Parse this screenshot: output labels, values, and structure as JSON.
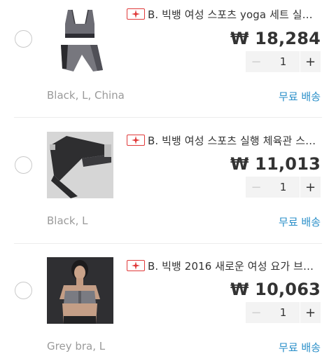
{
  "items": [
    {
      "title": "B. 빅뱅 여성 스포츠 yoga 세트 실…",
      "price": "₩ 18,284",
      "quantity": "1",
      "option": "Black, L, China",
      "shipping": "무료 배송",
      "image_icon": "sports-bra-and-leggings-image"
    },
    {
      "title": "B. 빅뱅 여성 스포츠 실행 체육관 스…",
      "price": "₩ 11,013",
      "quantity": "1",
      "option": "Black, L",
      "shipping": "무료 배송",
      "image_icon": "leggings-image"
    },
    {
      "title": "B. 빅뱅 2016 새로운 여성 요가 브…",
      "price": "₩ 10,063",
      "quantity": "1",
      "option": "Grey bra, L",
      "shipping": "무료 배송",
      "image_icon": "model-sports-bra-image"
    }
  ],
  "stepper": {
    "minus": "−",
    "plus": "+"
  },
  "colors": {
    "price": "#333333",
    "shipping_link": "#2a8fc9",
    "badge": "#e03a3a",
    "option_text": "#9a9a9a"
  }
}
